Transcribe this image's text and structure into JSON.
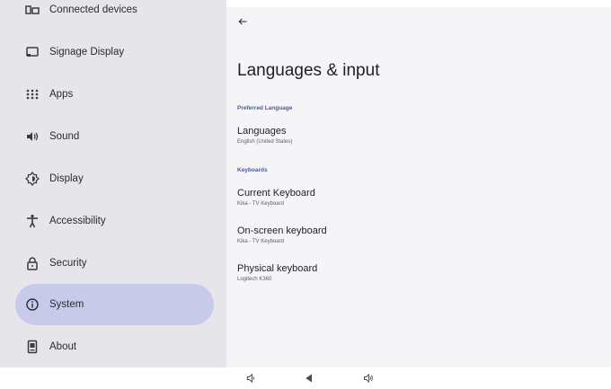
{
  "sidebar": {
    "items": [
      {
        "label": "Connected devices",
        "icon": "connected-devices-icon"
      },
      {
        "label": "Signage Display",
        "icon": "signage-display-icon"
      },
      {
        "label": "Apps",
        "icon": "apps-grid-icon"
      },
      {
        "label": "Sound",
        "icon": "speaker-icon"
      },
      {
        "label": "Display",
        "icon": "brightness-icon"
      },
      {
        "label": "Accessibility",
        "icon": "accessibility-person-icon"
      },
      {
        "label": "Security",
        "icon": "lock-icon"
      },
      {
        "label": "System",
        "icon": "info-circle-icon",
        "selected": true
      },
      {
        "label": "About",
        "icon": "device-icon"
      }
    ]
  },
  "main": {
    "back_icon": "arrow-back-icon",
    "title": "Languages & input",
    "sections": [
      {
        "header": "Preferred Language",
        "items": [
          {
            "title": "Languages",
            "subtitle": "English (United States)"
          }
        ]
      },
      {
        "header": "Keyboards",
        "items": [
          {
            "title": "Current Keyboard",
            "subtitle": "Kika - TV Keyboard"
          },
          {
            "title": "On-screen keyboard",
            "subtitle": "Kika - TV Keyboard"
          },
          {
            "title": "Physical keyboard",
            "subtitle": "Logitech K360"
          }
        ]
      }
    ]
  },
  "navbar": {
    "buttons": [
      "volume-down-icon",
      "back-triangle-icon",
      "volume-up-icon"
    ]
  },
  "colors": {
    "sidebar_bg": "#e6e5ea",
    "selected_bg": "#c7cbe9",
    "content_bg": "#f5f5f8",
    "section_header": "#4a5a9a"
  }
}
